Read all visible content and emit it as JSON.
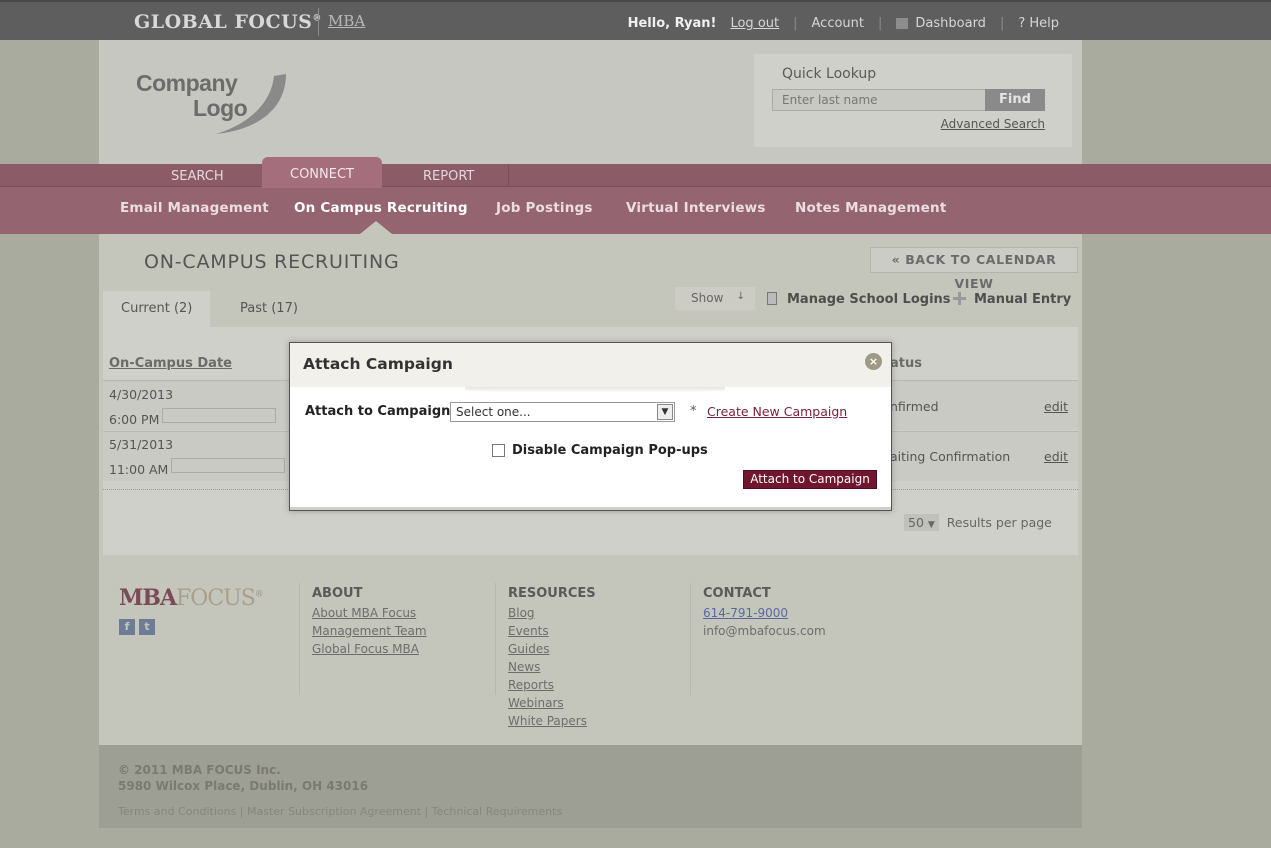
{
  "topbar": {
    "brand": "GLOBAL FOCUS",
    "brand_mark": "®",
    "brand_sub": "MBA",
    "greeting": "Hello, Ryan!",
    "logout": "Log out",
    "account": "Account",
    "dashboard": "Dashboard",
    "help": "? Help"
  },
  "logo": {
    "line1": "Company",
    "line2": "Logo"
  },
  "quick_lookup": {
    "title": "Quick Lookup",
    "placeholder": "Enter last name",
    "find": "Find",
    "advanced": "Advanced Search"
  },
  "nav": {
    "tabs": [
      "SEARCH",
      "CONNECT",
      "REPORT"
    ],
    "active_tab": "CONNECT",
    "subnav": [
      "Email Management",
      "On Campus Recruiting",
      "Job Postings",
      "Virtual Interviews",
      "Notes Management"
    ],
    "active_subnav": "On Campus Recruiting"
  },
  "content": {
    "title": "ON-CAMPUS RECRUITING",
    "back": "« BACK TO CALENDAR VIEW",
    "tabs": [
      "Current (2)",
      "Past (17)"
    ],
    "show": "Show",
    "manage_logins": "Manage School Logins",
    "manual_entry": "Manual Entry",
    "col_date": "On-Campus Date",
    "col_status": "atus",
    "rows": [
      {
        "date": "4/30/2013",
        "time": "6:00 PM",
        "status": "nfirmed",
        "action": "edit"
      },
      {
        "date": "5/31/2013",
        "time": "11:00 AM",
        "status": "aiting Confirmation",
        "action": "edit"
      }
    ],
    "per_page_value": "50",
    "per_page_label": "Results per page"
  },
  "modal": {
    "title": "Attach Campaign",
    "close_glyph": "×",
    "label": "Attach to Campaign:",
    "select_value": "Select one...",
    "select_arrow": "▼",
    "required": "*",
    "create_link": "Create New Campaign",
    "checkbox_label": "Disable Campaign Pop-ups",
    "checkbox_checked": false,
    "submit": "Attach to Campaign"
  },
  "footer": {
    "logo_mba": "MBA",
    "logo_focus": "FOCUS",
    "logo_mark": "®",
    "facebook_glyph": "f",
    "twitter_glyph": "t",
    "about": {
      "title": "ABOUT",
      "links": [
        "About MBA Focus",
        "Management Team",
        "Global Focus MBA"
      ]
    },
    "resources": {
      "title": "RESOURCES",
      "links": [
        "Blog",
        "Events",
        "Guides",
        "News",
        "Reports",
        "Webinars",
        "White Papers"
      ]
    },
    "contact": {
      "title": "CONTACT",
      "phone": "614-791-9000",
      "email": "info@mbafocus.com"
    },
    "copyright": "© 2011 MBA FOCUS Inc.",
    "address": "5980 Wilcox Place, Dublin, OH 43016",
    "legal": "Terms and Conditions | Master Subscription Agreement | Technical Requirements"
  },
  "colors": {
    "brand_maroon": "#70162e",
    "nav_band": "#946470",
    "topbar": "#5e5e5e"
  }
}
